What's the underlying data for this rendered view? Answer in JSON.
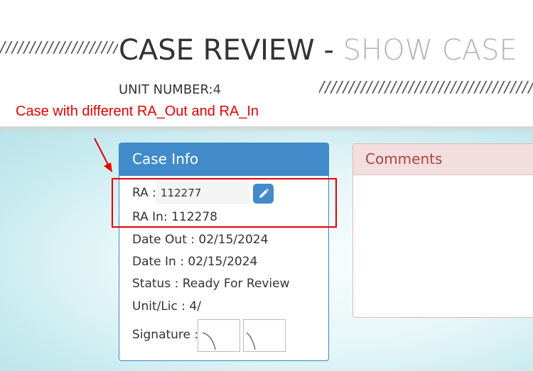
{
  "header": {
    "title_main": "CASE REVIEW",
    "title_sep": " - ",
    "title_sub": "SHOW CASE",
    "hatch_text": "////////////////////////////////////",
    "unit_label": "UNIT NUMBER:",
    "unit_value": "4"
  },
  "annotation": {
    "text": "Case with different RA_Out and RA_In",
    "color": "#e60000"
  },
  "case_info": {
    "title": "Case Info",
    "ra_label": "RA :",
    "ra_value": "112277",
    "edit_icon": "pencil-icon",
    "ra_in_label": "RA In:",
    "ra_in_value": "112278",
    "date_out_label": "Date Out :",
    "date_out_value": "02/15/2024",
    "date_in_label": "Date In :",
    "date_in_value": "02/15/2024",
    "status_label": "Status :",
    "status_value": "Ready For Review",
    "unit_lic_label": "Unit/Lic :",
    "unit_lic_value": "4/",
    "signature_label": "Signature :"
  },
  "comments": {
    "title": "Comments"
  },
  "colors": {
    "primary": "#428bca",
    "danger_bg": "#f2dede",
    "danger_text": "#a94442"
  }
}
